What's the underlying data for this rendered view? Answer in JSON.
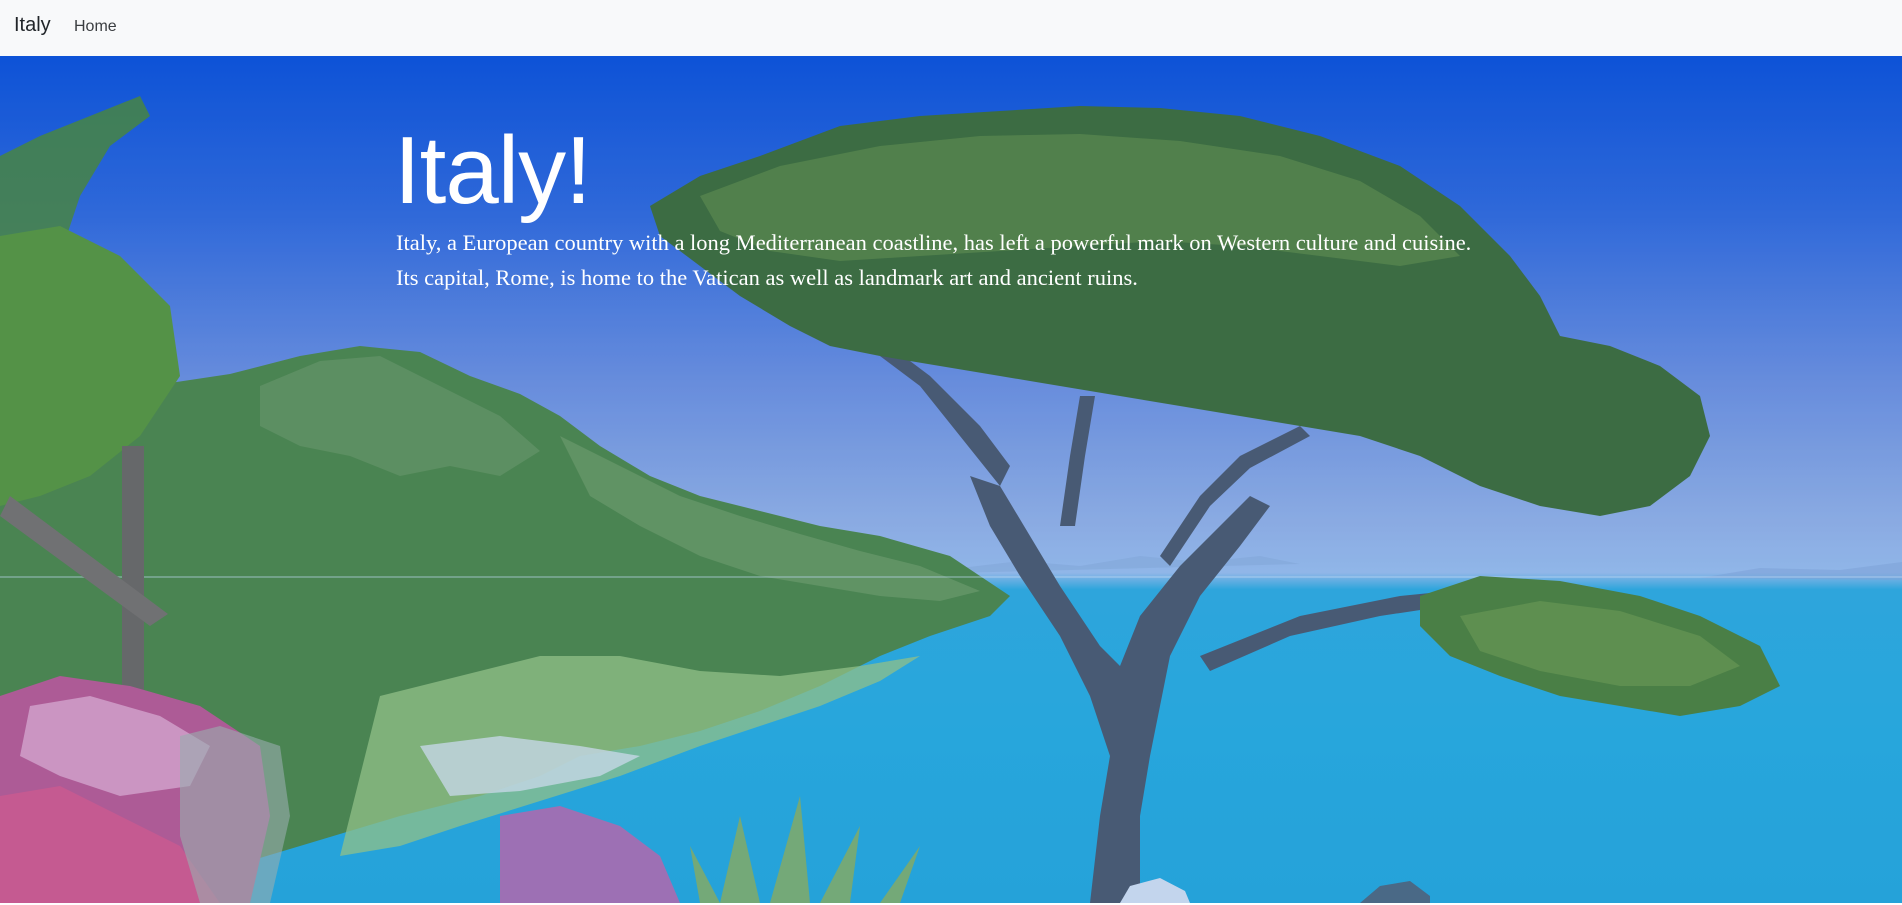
{
  "navbar": {
    "brand": "Italy",
    "links": [
      {
        "label": "Home"
      }
    ]
  },
  "hero": {
    "title": "Italy!",
    "description": "Italy, a European country with a long Mediterranean coastline, has left a powerful mark on Western culture and cuisine. Its capital, Rome, is home to the Vatican as well as landmark art and ancient ruins.",
    "background_image": "amalfi-coast-pine-tree-photo"
  },
  "colors": {
    "navbar_bg": "#f8f9fa",
    "sky_top": "#0a52d6",
    "sea": "#27b1dc",
    "hero_text": "#ffffff"
  }
}
